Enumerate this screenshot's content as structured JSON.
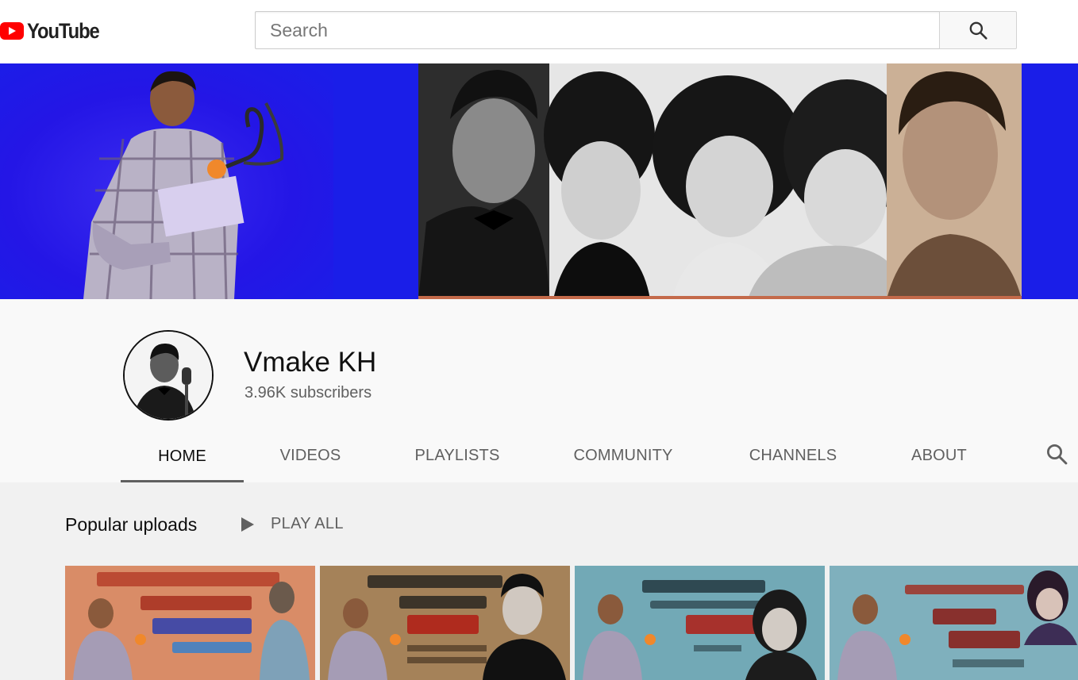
{
  "masthead": {
    "logo_text": "YouTube",
    "search_placeholder": "Search",
    "search_icon": "search-icon",
    "logo_icon": "youtube-play-icon",
    "brand_red": "#ff0000"
  },
  "channel": {
    "name": "Vmake KH",
    "subscribers": "3.96K subscribers"
  },
  "tabs": [
    {
      "label": "HOME",
      "active": true
    },
    {
      "label": "VIDEOS",
      "active": false
    },
    {
      "label": "PLAYLISTS",
      "active": false
    },
    {
      "label": "COMMUNITY",
      "active": false
    },
    {
      "label": "CHANNELS",
      "active": false
    },
    {
      "label": "ABOUT",
      "active": false
    }
  ],
  "tab_search_icon": "search-icon",
  "section": {
    "title": "Popular uploads",
    "play_all": "PLAY ALL",
    "play_icon": "play-icon"
  },
  "colors": {
    "banner_blue": "#1a1ee8",
    "header_bg": "#f9f9f9",
    "content_bg": "#f1f1f1"
  }
}
